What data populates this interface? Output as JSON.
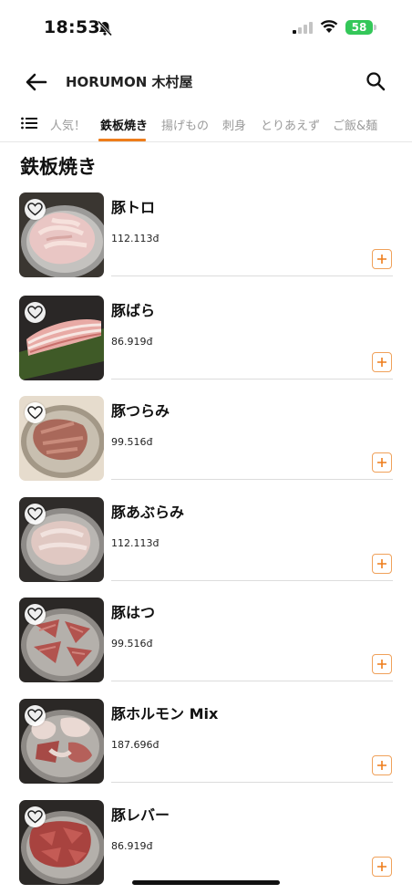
{
  "status_bar": {
    "time": "18:53",
    "battery": "58"
  },
  "header": {
    "title": "HORUMON 木村屋",
    "back_icon": "arrow-left-icon",
    "search_icon": "search-icon"
  },
  "tabs": [
    {
      "label": "人気！",
      "active": false
    },
    {
      "label": "鉄板焼き",
      "active": true
    },
    {
      "label": "揚げもの",
      "active": false
    },
    {
      "label": "刺身",
      "active": false
    },
    {
      "label": "とりあえず",
      "active": false
    },
    {
      "label": "ご飯&麺",
      "active": false
    }
  ],
  "section": {
    "title": "鉄板焼き"
  },
  "items": [
    {
      "name": "豚トロ",
      "price": "112.113đ",
      "image": "pork-jowl-plate"
    },
    {
      "name": "豚ばら",
      "price": "86.919đ",
      "image": "pork-belly-plate"
    },
    {
      "name": "豚つらみ",
      "price": "99.516đ",
      "image": "pork-cheek-plate"
    },
    {
      "name": "豚あぶらみ",
      "price": "112.113đ",
      "image": "pork-fat-plate"
    },
    {
      "name": "豚はつ",
      "price": "99.516đ",
      "image": "pork-heart-plate"
    },
    {
      "name": "豚ホルモン Mix",
      "price": "187.696đ",
      "image": "pork-offal-mix-plate"
    },
    {
      "name": "豚レバー",
      "price": "86.919đ",
      "image": "pork-liver-plate"
    }
  ],
  "colors": {
    "accent": "#ee7d1b",
    "add_button_border": "#f0a15a",
    "battery": "#34c759",
    "tab_inactive": "#9a9a9a"
  }
}
